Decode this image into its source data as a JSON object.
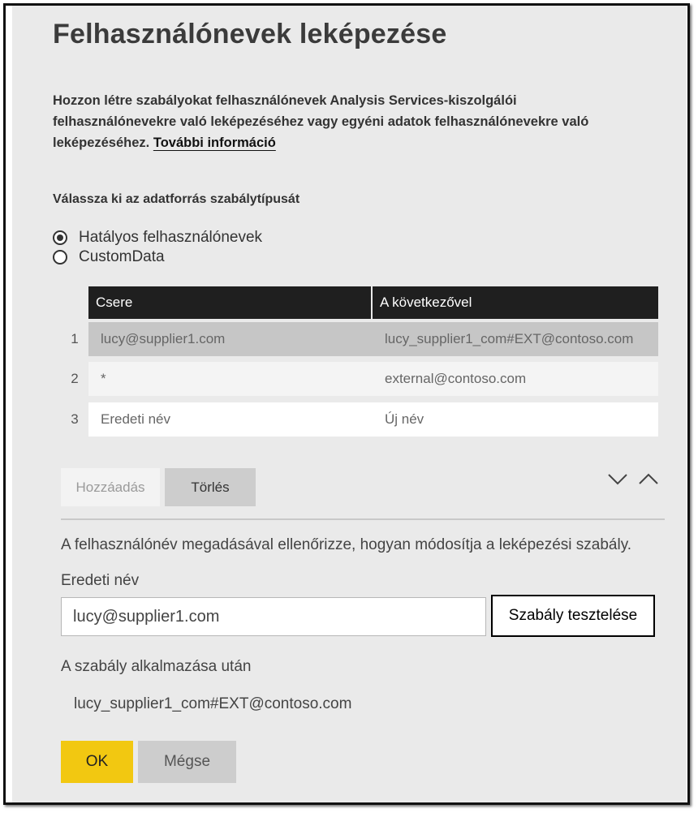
{
  "dialog": {
    "title": "Felhasználónevek leképezése",
    "description": "Hozzon létre szabályokat felhasználónevek Analysis Services-kiszolgálói felhasználónevekre való leképezéséhez vagy egyéni adatok felhasználónevekre való leképezéséhez.",
    "learn_more_link": "További információ"
  },
  "rule_type": {
    "label": "Válassza ki az adatforrás szabálytípusát",
    "options": [
      {
        "label": "Hatályos felhasználónevek",
        "selected": true
      },
      {
        "label": "CustomData",
        "selected": false
      }
    ]
  },
  "rules_table": {
    "headers": [
      "Csere",
      "A következővel"
    ],
    "rows": [
      {
        "num": "1",
        "replace": "lucy@supplier1.com",
        "with": "lucy_supplier1_com#EXT@contoso.com",
        "selected": true
      },
      {
        "num": "2",
        "replace": "*",
        "with": "external@contoso.com",
        "selected": false
      },
      {
        "num": "3",
        "replace": "Eredeti név",
        "with": "Új név",
        "selected": false
      }
    ]
  },
  "actions": {
    "add_label": "Hozzáadás",
    "delete_label": "Törlés",
    "move_down_icon": "chevron-down-icon",
    "move_up_icon": "chevron-up-icon"
  },
  "test": {
    "info": "A felhasználónév megadásával ellenőrizze, hogyan módosítja a leképezési szabály.",
    "field_label": "Eredeti név",
    "input_value": "lucy@supplier1.com",
    "test_button": "Szabály tesztelése",
    "after_label": "A szabály alkalmazása után",
    "result": "lucy_supplier1_com#EXT@contoso.com"
  },
  "footer": {
    "ok_label": "OK",
    "cancel_label": "Mégse"
  },
  "colors": {
    "accent": "#f2c811",
    "header_bg": "#1f1f1f",
    "panel_bg": "#eaeaea"
  }
}
